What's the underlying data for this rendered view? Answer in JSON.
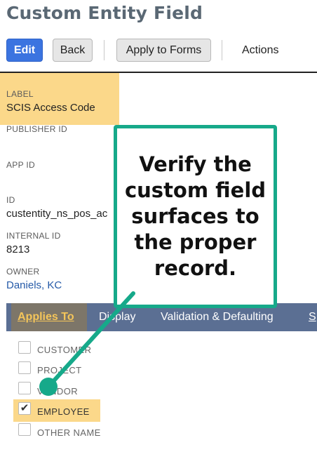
{
  "page": {
    "title": "Custom Entity Field"
  },
  "toolbar": {
    "edit_label": "Edit",
    "back_label": "Back",
    "apply_label": "Apply to Forms",
    "actions_label": "Actions"
  },
  "fields": {
    "label": {
      "name": "LABEL",
      "value": "SCIS Access Code"
    },
    "publisher": {
      "name": "PUBLISHER ID",
      "value": ""
    },
    "app": {
      "name": "APP ID",
      "value": ""
    },
    "id": {
      "name": "ID",
      "value": "custentity_ns_pos_ac"
    },
    "internal": {
      "name": "INTERNAL ID",
      "value": "8213"
    },
    "owner": {
      "name": "OWNER",
      "value": "Daniels, KC"
    }
  },
  "tabs": [
    {
      "label": "Applies To",
      "active": true
    },
    {
      "label": "Display",
      "active": false
    },
    {
      "label": "Validation & Defaulting",
      "active": false
    },
    {
      "label": "S",
      "active": false
    }
  ],
  "applies_to": [
    {
      "label": "CUSTOMER",
      "checked": false
    },
    {
      "label": "PROJECT",
      "checked": false
    },
    {
      "label": "VENDOR",
      "checked": false
    },
    {
      "label": "EMPLOYEE",
      "checked": true
    },
    {
      "label": "OTHER NAME",
      "checked": false
    }
  ],
  "callout": {
    "text": "Verify the custom field surfaces to the proper record."
  },
  "colors": {
    "primary_button": "#3b74e0",
    "highlight": "#fbd88a",
    "callout_border": "#16a98a",
    "tab_bar": "#5b6f93",
    "active_tab": "#7d7669",
    "active_tab_text": "#f4c55a",
    "link": "#255aa8"
  },
  "icons": {
    "checkmark": "check-icon"
  }
}
